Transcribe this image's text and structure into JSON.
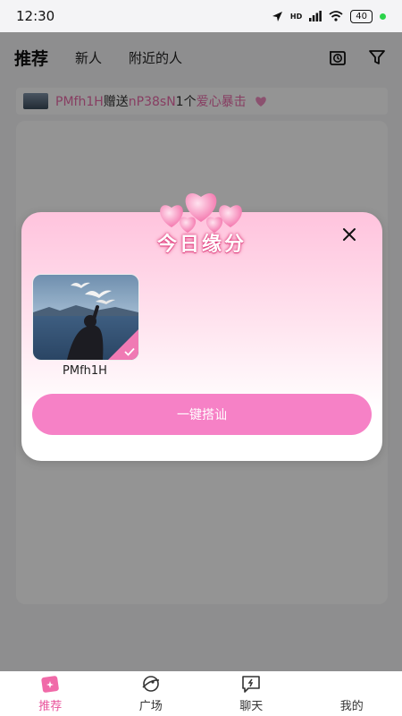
{
  "status": {
    "time": "12:30",
    "battery": "40",
    "network": "HD"
  },
  "top_tabs": [
    {
      "label": "推荐"
    },
    {
      "label": "新人"
    },
    {
      "label": "附近的人"
    }
  ],
  "top_icons": [
    "clock-icon",
    "filter-icon"
  ],
  "ticker": {
    "sender": "PMfh1H",
    "verb": "赠送",
    "receiver": "nP38sN",
    "count": "1个",
    "gift": "爱心暴击"
  },
  "modal": {
    "title": "今日缘分",
    "profiles": [
      {
        "name": "PMfh1H",
        "selected": true
      }
    ],
    "button_label": "一键搭讪"
  },
  "bottom_nav": [
    {
      "label": "推荐"
    },
    {
      "label": "广场"
    },
    {
      "label": "聊天"
    },
    {
      "label": "我的"
    }
  ],
  "colors": {
    "accent": "#e9559c",
    "button": "#f681c6",
    "modal_top": "#ffc3dd"
  }
}
